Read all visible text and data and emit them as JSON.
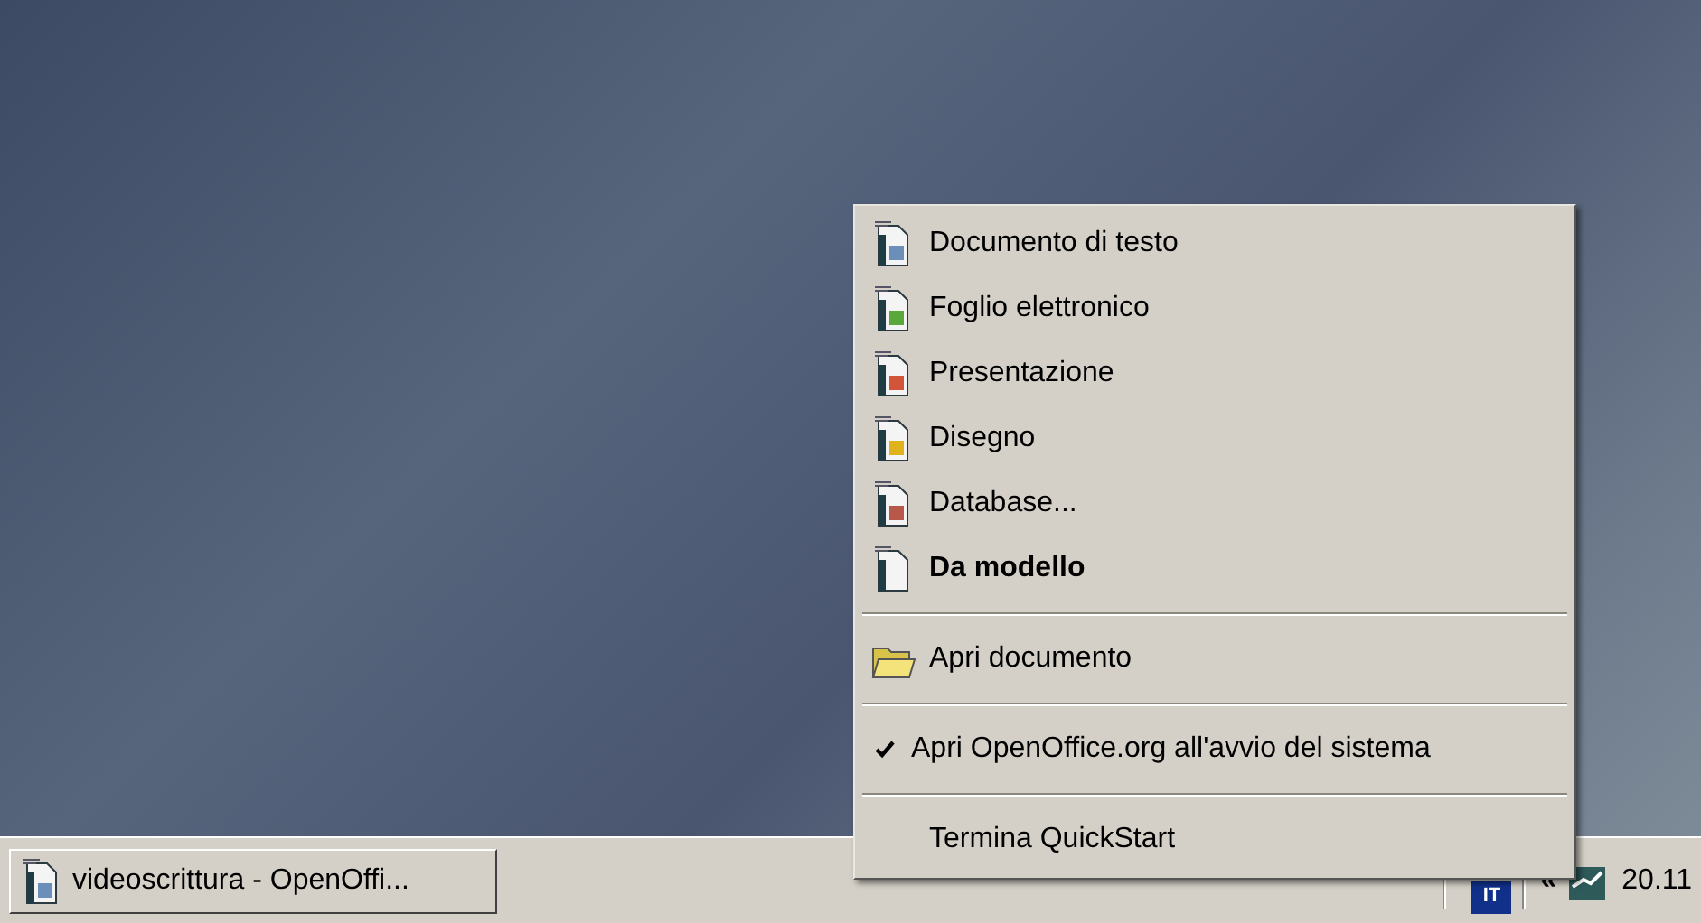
{
  "menu": {
    "items": [
      {
        "kind": "app",
        "label": "Documento di testo",
        "color": "#6b8fb8",
        "default": false
      },
      {
        "kind": "app",
        "label": "Foglio elettronico",
        "color": "#5aa83c",
        "default": false
      },
      {
        "kind": "app",
        "label": "Presentazione",
        "color": "#d2553a",
        "default": false
      },
      {
        "kind": "app",
        "label": "Disegno",
        "color": "#e0b21c",
        "default": false
      },
      {
        "kind": "app",
        "label": "Database...",
        "color": "#b8584a",
        "default": false
      },
      {
        "kind": "template",
        "label": "Da modello",
        "default": true
      },
      {
        "kind": "separator"
      },
      {
        "kind": "folder",
        "label": "Apri documento",
        "default": false
      },
      {
        "kind": "separator"
      },
      {
        "kind": "check",
        "label": "Apri OpenOffice.org all'avvio del sistema",
        "checked": true
      },
      {
        "kind": "separator"
      },
      {
        "kind": "plain",
        "label": "Termina QuickStart",
        "default": false
      }
    ]
  },
  "taskbar": {
    "button": {
      "label": "videoscrittura - OpenOffi..."
    },
    "language": "IT",
    "chevron": "«",
    "clock": "20.11"
  }
}
